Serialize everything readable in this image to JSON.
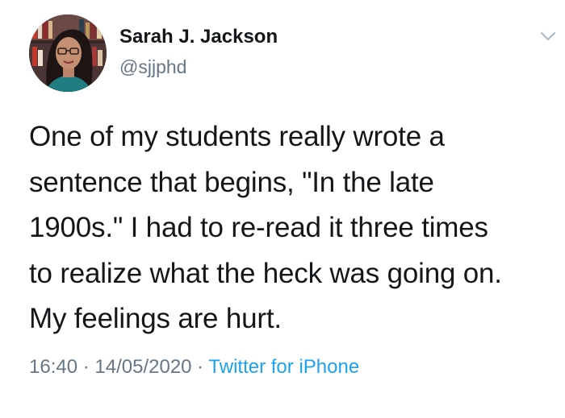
{
  "author": {
    "display_name": "Sarah J. Jackson",
    "handle": "@sjjphd",
    "avatar_icon": "profile-photo-avatar"
  },
  "tweet": {
    "lines": [
      "One of my students really wrote a",
      "sentence that begins, \"In the late",
      "1900s.\" I had to re-read it three times",
      "to realize what the heck was going on.",
      "My feelings are hurt."
    ]
  },
  "meta": {
    "time": "16:40",
    "separator": " · ",
    "date": "14/05/2020",
    "source": "Twitter for iPhone"
  },
  "menu": {
    "icon": "chevron-down-icon"
  },
  "colors": {
    "text": "#14171a",
    "secondary": "#657786",
    "link": "#1da1f2"
  }
}
